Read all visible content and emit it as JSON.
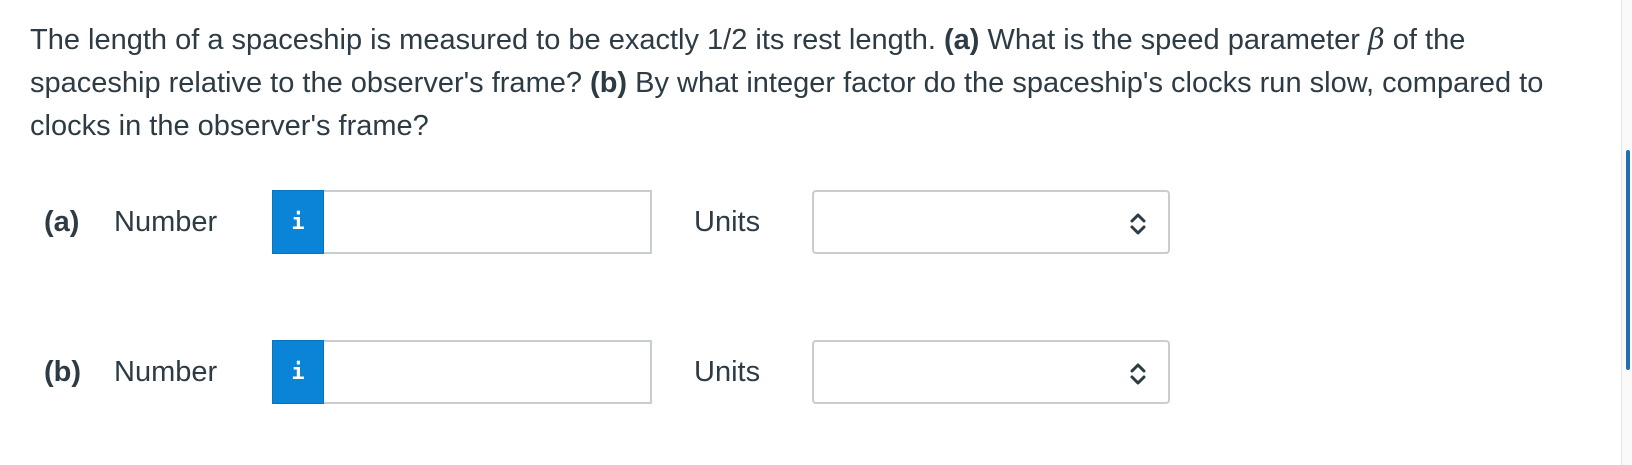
{
  "question": {
    "intro": "The length of a spaceship is measured to be exactly 1/2 its rest length. ",
    "part_a_tag": "(a)",
    "part_a_text_1": " What is the speed parameter ",
    "beta": "β",
    "part_a_text_2": " of the spaceship relative to the observer's frame? ",
    "part_b_tag": "(b)",
    "part_b_text": " By what integer factor do the spaceship's clocks run slow, compared to clocks in the observer's frame?"
  },
  "answers": [
    {
      "part": "(a)",
      "number_label": "Number",
      "info_icon": "i",
      "number_value": "",
      "units_label": "Units",
      "units_value": ""
    },
    {
      "part": "(b)",
      "number_label": "Number",
      "info_icon": "i",
      "number_value": "",
      "units_label": "Units",
      "units_value": ""
    }
  ],
  "colors": {
    "info_button": "#0a84d6",
    "text": "#2d3b45",
    "border": "#c7cdd1",
    "scroll_thumb": "#1f6fb2"
  },
  "icons": {
    "info": "info-icon",
    "select_chevron": "chevron-up-down-icon"
  }
}
